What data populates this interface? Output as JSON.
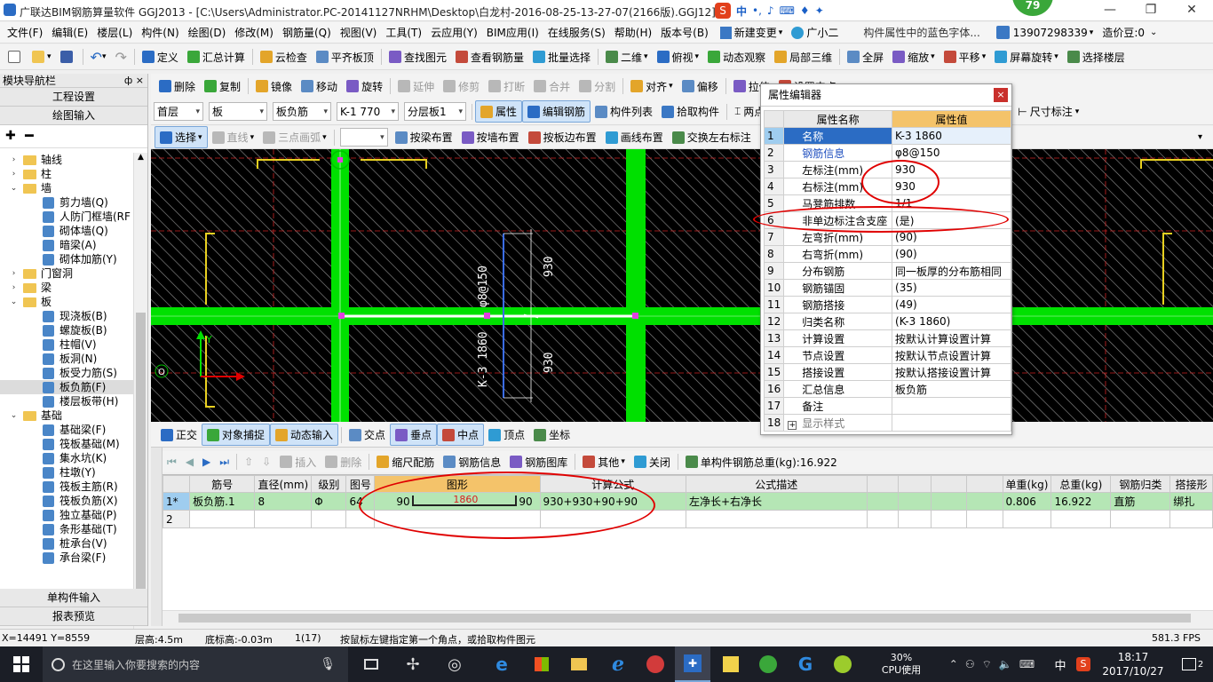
{
  "titlebar": {
    "title": "广联达BIM钢筋算量软件 GGJ2013 - [C:\\Users\\Administrator.PC-20141127NRHM\\Desktop\\白龙村-2016-08-25-13-27-07(2166版).GGJ12]",
    "badge": "79",
    "ime_label": "中"
  },
  "menubar": {
    "items": [
      "文件(F)",
      "编辑(E)",
      "楼层(L)",
      "构件(N)",
      "绘图(D)",
      "修改(M)",
      "钢筋量(Q)",
      "视图(V)",
      "工具(T)",
      "云应用(Y)",
      "BIM应用(I)",
      "在线服务(S)",
      "帮助(H)",
      "版本号(B)"
    ],
    "new_change": "新建变更",
    "guang": "广小二",
    "marquee": "构件属性中的蓝色字体...",
    "phone": "13907298339",
    "price": "造价豆:0"
  },
  "toolbar1": [
    "定义",
    "汇总计算",
    "云检查",
    "平齐板顶",
    "查找图元",
    "查看钢筋量",
    "批量选择",
    "二维",
    "俯视",
    "动态观察",
    "局部三维",
    "全屏",
    "缩放",
    "平移",
    "屏幕旋转",
    "选择楼层"
  ],
  "toolbar2": [
    "删除",
    "复制",
    "镜像",
    "移动",
    "旋转",
    "延伸",
    "修剪",
    "打断",
    "合并",
    "分割",
    "对齐",
    "偏移",
    "拉伸",
    "设置夹点"
  ],
  "toolbar3": {
    "floor": "首层",
    "type": "板",
    "sub": "板负筋",
    "member": "K-1 770",
    "layer": "分层板1",
    "attr": "属性",
    "edit_rebar": "编辑钢筋",
    "list": "构件列表",
    "pick": "拾取构件",
    "two_point": "两点",
    "dim": "尺寸标注"
  },
  "toolbar4": [
    "选择",
    "直线",
    "三点画弧",
    "按梁布置",
    "按墙布置",
    "按板边布置",
    "画线布置",
    "交换左右标注"
  ],
  "nav": {
    "header": "模块导航栏",
    "pin": "ф ×",
    "btn_project": "工程设置",
    "btn_draw": "绘图输入",
    "btn_single": "单构件输入",
    "btn_report": "报表预览",
    "tree": [
      {
        "level": 0,
        "exp": "+",
        "type": "folder",
        "label": "轴线"
      },
      {
        "level": 0,
        "exp": "+",
        "type": "folder",
        "label": "柱"
      },
      {
        "level": 0,
        "exp": "-",
        "type": "folder",
        "label": "墙"
      },
      {
        "level": 1,
        "type": "leaf",
        "label": "剪力墙(Q)"
      },
      {
        "level": 1,
        "type": "leaf",
        "label": "人防门框墙(RF"
      },
      {
        "level": 1,
        "type": "leaf",
        "label": "砌体墙(Q)"
      },
      {
        "level": 1,
        "type": "leaf",
        "label": "暗梁(A)"
      },
      {
        "level": 1,
        "type": "leaf",
        "label": "砌体加筋(Y)"
      },
      {
        "level": 0,
        "exp": "+",
        "type": "folder",
        "label": "门窗洞"
      },
      {
        "level": 0,
        "exp": "+",
        "type": "folder",
        "label": "梁"
      },
      {
        "level": 0,
        "exp": "-",
        "type": "folder",
        "label": "板"
      },
      {
        "level": 1,
        "type": "leaf",
        "label": "现浇板(B)"
      },
      {
        "level": 1,
        "type": "leaf",
        "label": "螺旋板(B)"
      },
      {
        "level": 1,
        "type": "leaf",
        "label": "柱帽(V)"
      },
      {
        "level": 1,
        "type": "leaf",
        "label": "板洞(N)"
      },
      {
        "level": 1,
        "type": "leaf",
        "label": "板受力筋(S)"
      },
      {
        "level": 1,
        "type": "leaf",
        "label": "板负筋(F)",
        "selected": true
      },
      {
        "level": 1,
        "type": "leaf",
        "label": "楼层板带(H)"
      },
      {
        "level": 0,
        "exp": "-",
        "type": "folder",
        "label": "基础"
      },
      {
        "level": 1,
        "type": "leaf",
        "label": "基础梁(F)"
      },
      {
        "level": 1,
        "type": "leaf",
        "label": "筏板基础(M)"
      },
      {
        "level": 1,
        "type": "leaf",
        "label": "集水坑(K)"
      },
      {
        "level": 1,
        "type": "leaf",
        "label": "柱墩(Y)"
      },
      {
        "level": 1,
        "type": "leaf",
        "label": "筏板主筋(R)"
      },
      {
        "level": 1,
        "type": "leaf",
        "label": "筏板负筋(X)"
      },
      {
        "level": 1,
        "type": "leaf",
        "label": "独立基础(P)"
      },
      {
        "level": 1,
        "type": "leaf",
        "label": "条形基础(T)"
      },
      {
        "level": 1,
        "type": "leaf",
        "label": "桩承台(V)"
      },
      {
        "level": 1,
        "type": "leaf",
        "label": "承台梁(F)"
      }
    ]
  },
  "canvas": {
    "dim_top": "930",
    "dim_bottom": "930",
    "label": "K-3 1860",
    "spec": "φ8@150",
    "axis_y": "Y",
    "axis_origin": "O"
  },
  "snapbar": [
    "正交",
    "对象捕捉",
    "动态输入",
    "交点",
    "垂点",
    "中点",
    "顶点",
    "坐标"
  ],
  "gridbar": [
    "插入",
    "删除",
    "缩尺配筋",
    "钢筋信息",
    "钢筋图库",
    "其他",
    "关闭",
    "单构件钢筋总重(kg):16.922"
  ],
  "grid": {
    "headers": [
      "",
      "筋号",
      "直径(mm)",
      "级别",
      "图号",
      "图形",
      "计算公式",
      "公式描述",
      "",
      "",
      "",
      "",
      "单重(kg)",
      "总重(kg)",
      "钢筋归类",
      "搭接形"
    ],
    "rows": [
      {
        "idx": "1*",
        "name": "板负筋.1",
        "dia": "8",
        "grade": "Φ",
        "fig": "64",
        "left": "90",
        "mid": "1860",
        "right": "90",
        "formula": "930+930+90+90",
        "desc": "左净长+右净长",
        "unit": "0.806",
        "total": "16.922",
        "cls": "直筋",
        "lap": "绑扎"
      },
      {
        "idx": "2",
        "name": "",
        "dia": "",
        "grade": "",
        "fig": "",
        "left": "",
        "mid": "",
        "right": "",
        "formula": "",
        "desc": "",
        "unit": "",
        "total": "",
        "cls": "",
        "lap": ""
      }
    ]
  },
  "prop": {
    "title": "属性编辑器",
    "col_name": "属性名称",
    "col_value": "属性值",
    "rows": [
      {
        "n": "1",
        "name": "名称",
        "value": "K-3 1860",
        "blue": true
      },
      {
        "n": "2",
        "name": "钢筋信息",
        "value": "φ8@150",
        "blue": true
      },
      {
        "n": "3",
        "name": "左标注(mm)",
        "value": "930",
        "blue": false
      },
      {
        "n": "4",
        "name": "右标注(mm)",
        "value": "930",
        "blue": false
      },
      {
        "n": "5",
        "name": "马凳筋排数",
        "value": "1/1",
        "blue": false
      },
      {
        "n": "6",
        "name": "非单边标注含支座",
        "value": "(是)",
        "blue": false
      },
      {
        "n": "7",
        "name": "左弯折(mm)",
        "value": "(90)",
        "blue": false
      },
      {
        "n": "8",
        "name": "右弯折(mm)",
        "value": "(90)",
        "blue": false
      },
      {
        "n": "9",
        "name": "分布钢筋",
        "value": "同一板厚的分布筋相同",
        "blue": false
      },
      {
        "n": "10",
        "name": "钢筋锚固",
        "value": "(35)",
        "blue": false
      },
      {
        "n": "11",
        "name": "钢筋搭接",
        "value": "(49)",
        "blue": false
      },
      {
        "n": "12",
        "name": "归类名称",
        "value": "(K-3 1860)",
        "blue": false
      },
      {
        "n": "13",
        "name": "计算设置",
        "value": "按默认计算设置计算",
        "blue": false
      },
      {
        "n": "14",
        "name": "节点设置",
        "value": "按默认节点设置计算",
        "blue": false
      },
      {
        "n": "15",
        "name": "搭接设置",
        "value": "按默认搭接设置计算",
        "blue": false
      },
      {
        "n": "16",
        "name": "汇总信息",
        "value": "板负筋",
        "blue": false
      },
      {
        "n": "17",
        "name": "备注",
        "value": "",
        "blue": false
      },
      {
        "n": "18",
        "name": "显示样式",
        "value": "",
        "blue": false,
        "expand": true
      }
    ]
  },
  "status": {
    "coords": "X=14491 Y=8559",
    "floor_h": "层高:4.5m",
    "base_h": "底标高:-0.03m",
    "count": "1(17)",
    "hint": "按鼠标左键指定第一个角点，或拾取构件图元",
    "fps": "581.3 FPS"
  },
  "taskbar": {
    "search": "在这里输入你要搜索的内容",
    "cpu": "30%",
    "cpu_label": "CPU使用",
    "ime": "中",
    "time": "18:17",
    "date": "2017/10/27",
    "notif": "2"
  },
  "colors": {
    "canvas_bg": "#000000",
    "beam_green": "#00e000",
    "hatch": "#7a7a7a",
    "accent_blue": "#2b6cc4",
    "annotation_red": "#e00000",
    "formula_highlight": "#b5e6b5"
  }
}
